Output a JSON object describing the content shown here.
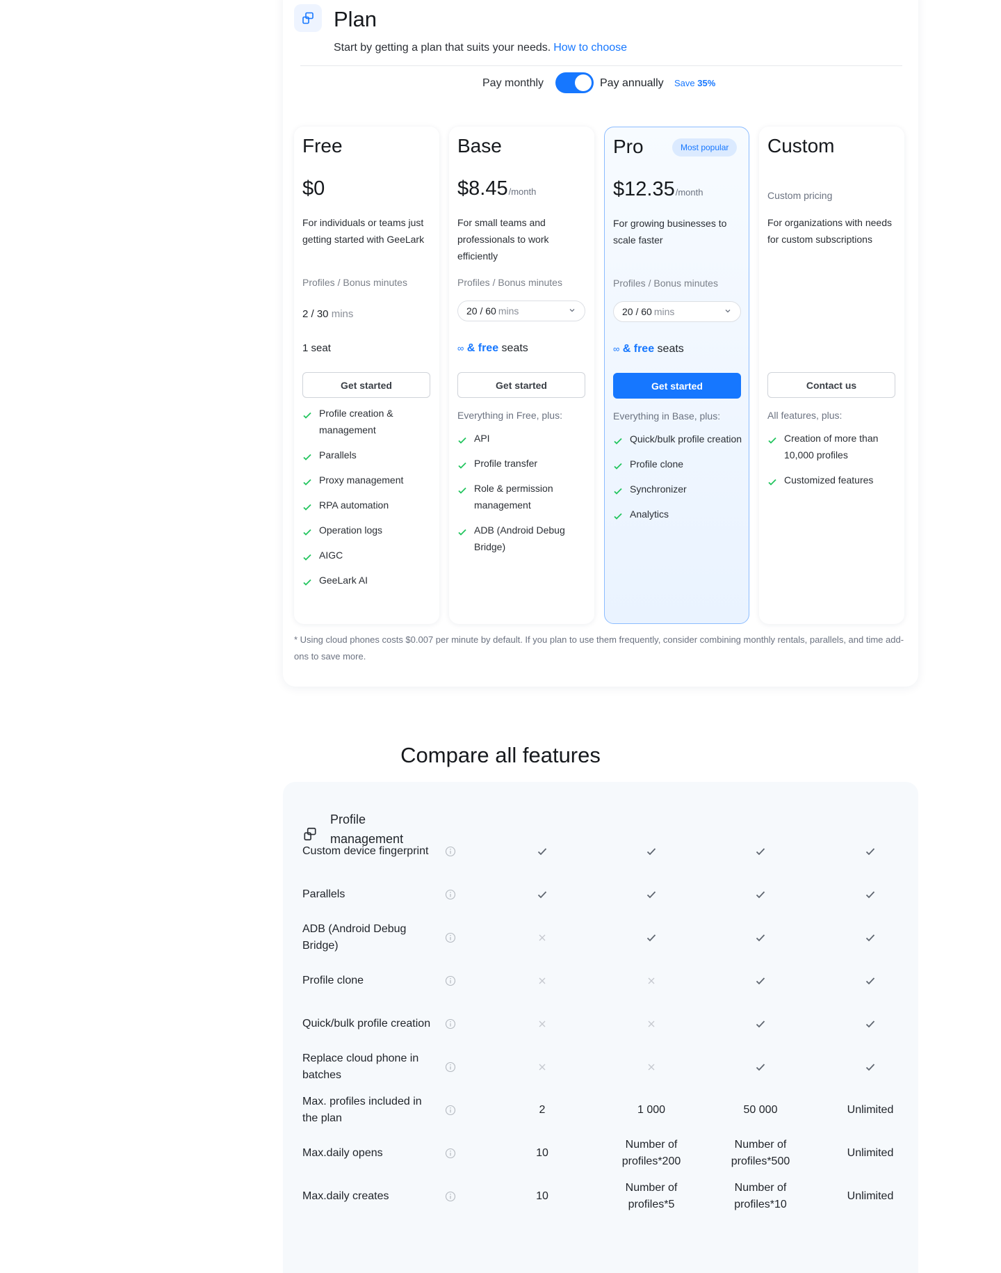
{
  "plan": {
    "title": "Plan",
    "subtitle": "Start by getting a plan that suits your needs.",
    "how_to_choose": "How to choose",
    "billing": {
      "monthly_label": "Pay monthly",
      "annually_label": "Pay annually",
      "save_prefix": "Save",
      "save_value": "35%",
      "annual_selected": true
    },
    "tiers": [
      {
        "name": "Free",
        "price": "$0",
        "per": "",
        "description": "For individuals or teams just getting started with GeeLark",
        "profiles_label": "Profiles / Bonus minutes",
        "profiles_value": "2 / 30",
        "mins": "mins",
        "seats": "1 seat",
        "cta": "Get started",
        "features": [
          "Profile creation & management",
          "Parallels",
          "Proxy management",
          "RPA automation",
          "Operation logs",
          "AIGC",
          "GeeLark AI"
        ]
      },
      {
        "name": "Base",
        "price": "$8.45",
        "per": "/month",
        "description": "For small teams and professionals to work efficiently",
        "profiles_label": "Profiles / Bonus minutes",
        "profiles_value": "20 / 60",
        "mins": "mins",
        "seats_inf": "∞",
        "seats_free": "& free",
        "seats_word": "seats",
        "cta": "Get started",
        "features_intro": "Everything in Free, plus:",
        "features": [
          "API",
          "Profile transfer",
          "Role & permission management",
          "ADB (Android Debug Bridge)"
        ]
      },
      {
        "name": "Pro",
        "badge": "Most popular",
        "price": "$12.35",
        "per": "/month",
        "description": "For growing businesses to scale faster",
        "profiles_label": "Profiles / Bonus minutes",
        "profiles_value": "20 / 60",
        "mins": "mins",
        "seats_inf": "∞",
        "seats_free": "& free",
        "seats_word": "seats",
        "cta": "Get started",
        "features_intro": "Everything in Base, plus:",
        "features": [
          "Quick/bulk profile creation",
          "Profile clone",
          "Synchronizer",
          "Analytics"
        ]
      },
      {
        "name": "Custom",
        "price_text": "Custom pricing",
        "description": "For organizations with needs for custom subscriptions",
        "cta": "Contact us",
        "features_intro": "All features, plus:",
        "features": [
          "Creation of more than 10,000 profiles",
          "Customized features"
        ]
      }
    ],
    "footnote": "* Using cloud phones costs $0.007 per minute by default. If you plan to use them frequently, consider combining monthly rentals, parallels, and time add-ons to save more."
  },
  "compare": {
    "title": "Compare all features",
    "section_title": "Profile management",
    "rows": [
      {
        "label": "Custom device fingerprint",
        "cells": [
          "check",
          "check",
          "check",
          "check"
        ]
      },
      {
        "label": "Parallels",
        "cells": [
          "check",
          "check",
          "check",
          "check"
        ]
      },
      {
        "label": "ADB (Android Debug Bridge)",
        "cells": [
          "cross",
          "check",
          "check",
          "check"
        ]
      },
      {
        "label": "Profile clone",
        "cells": [
          "cross",
          "cross",
          "check",
          "check"
        ]
      },
      {
        "label": "Quick/bulk profile creation",
        "cells": [
          "cross",
          "cross",
          "check",
          "check"
        ]
      },
      {
        "label": "Replace cloud phone in batches",
        "cells": [
          "cross",
          "cross",
          "check",
          "check"
        ]
      },
      {
        "label": "Max. profiles included in the plan",
        "cells": [
          "2",
          "1 000",
          "50 000",
          "Unlimited"
        ]
      },
      {
        "label": "Max.daily opens",
        "cells": [
          "10",
          "Number of profiles*200",
          "Number of profiles*500",
          "Unlimited"
        ]
      },
      {
        "label": "Max.daily creates",
        "cells": [
          "10",
          "Number of profiles*5",
          "Number of profiles*10",
          "Unlimited"
        ]
      }
    ]
  },
  "colors": {
    "accent": "#1677ff",
    "check_green": "#22c55e",
    "check_gray": "#5f6670",
    "cross_gray": "#c4c8ce"
  },
  "icons": {
    "plan": "profile-cards-icon",
    "info": "info-circle-icon",
    "check": "check-icon",
    "cross": "cross-icon",
    "chevron": "chevron-down-icon"
  }
}
